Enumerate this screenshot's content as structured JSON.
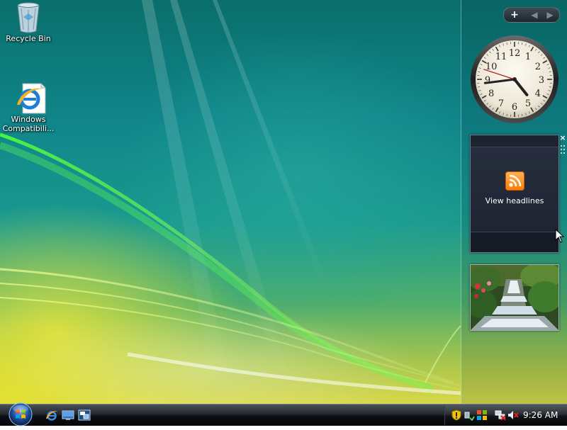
{
  "desktop": {
    "icons": [
      {
        "label": "Recycle Bin",
        "icon": "recycle-bin-icon"
      },
      {
        "label": "Windows Compatibili...",
        "icon": "ie-document-icon"
      }
    ]
  },
  "sidebar": {
    "controls": {
      "add": "+",
      "prev": "◀",
      "next": "▶"
    },
    "clock": {
      "hour": 4,
      "minute": 43,
      "second": 48
    },
    "feed": {
      "label": "View headlines",
      "close": "×"
    }
  },
  "taskbar": {
    "quick_launch": [
      "ie-icon",
      "show-desktop-icon",
      "switch-windows-icon"
    ],
    "tray": {
      "icons": [
        "security-shield-icon",
        "connect-icon",
        "windows-security-icon",
        "network-icon",
        "volume-muted-icon"
      ],
      "time": "9:26 AM"
    }
  },
  "colors": {
    "accent_orange": "#ff8a1a",
    "taskbar": "#1a1e24"
  }
}
